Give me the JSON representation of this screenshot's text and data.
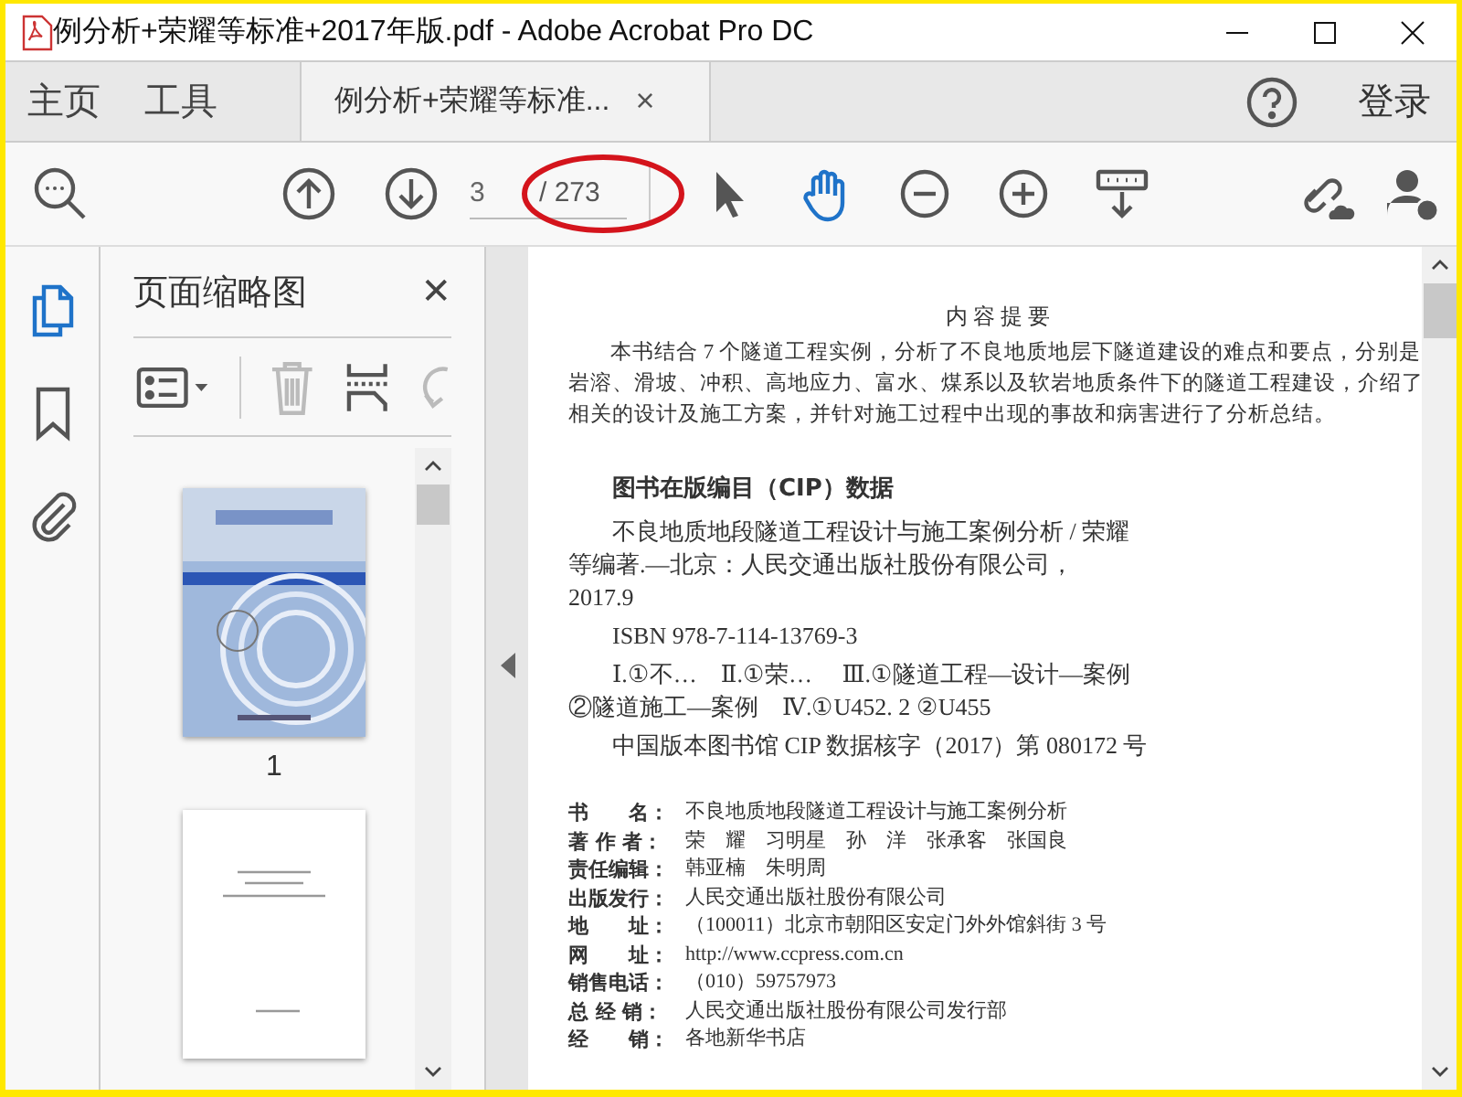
{
  "window": {
    "title": "例分析+荣耀等标准+2017年版.pdf - Adobe Acrobat Pro DC"
  },
  "nav_tabs": [
    {
      "label": "主页",
      "selected": false
    },
    {
      "label": "工具",
      "selected": false
    }
  ],
  "document_tab": {
    "label": "例分析+荣耀等标准...",
    "close": "×"
  },
  "account": {
    "login": "登录"
  },
  "toolbar": {
    "page_number": "3",
    "page_total": "/ 273",
    "tools": [
      {
        "kind": "select",
        "selected": false
      },
      {
        "kind": "hand",
        "selected": true
      }
    ]
  },
  "side_rail": [
    {
      "kind": "pages",
      "selected": true
    },
    {
      "kind": "bookmarks",
      "selected": false
    },
    {
      "kind": "attachments",
      "selected": false
    }
  ],
  "thumbnail_panel": {
    "title": "页面缩略图",
    "close": "✕",
    "thumbnails": [
      {
        "kind": "picture",
        "label": "1",
        "selected": false
      },
      {
        "kind": "page",
        "selected": false
      }
    ]
  },
  "page": {
    "heading": "内 容 提 要",
    "summary": "本书结合 7 个隧道工程实例，分析了不良地质地层下隧道建设的难点和要点，分别是岩溶、滑坡、冲积、高地应力、富水、煤系以及软岩地质条件下的隧道工程建设，介绍了相关的设计及施工方案，并针对施工过程中出现的事故和病害进行了分析总结。",
    "cip_title": "图书在版编目（CIP）数据",
    "cip_lines": [
      {
        "text": "不良地质地段隧道工程设计与施工案例分析 / 荣耀",
        "indent": true
      },
      {
        "text": "等编著.—北京：人民交通出版社股份有限公司，",
        "indent": false
      },
      {
        "text": "2017.9",
        "indent": false
      },
      {
        "text": "ISBN 978-7-114-13769-3",
        "indent": true
      },
      {
        "text": "Ⅰ.①不…　Ⅱ.①荣…　 Ⅲ.①隧道工程—设计—案例",
        "indent": true
      },
      {
        "text": "②隧道施工—案例　Ⅳ.①U452. 2 ②U455",
        "indent": false
      },
      {
        "text": "中国版本图书馆 CIP 数据核字（2017）第 080172 号",
        "indent": true
      }
    ],
    "details": [
      {
        "label": "书　　名：",
        "value": "不良地质地段隧道工程设计与施工案例分析"
      },
      {
        "label": "著 作 者：",
        "value": "荣　耀　习明星　孙　洋　张承客　张国良"
      },
      {
        "label": "责任编辑：",
        "value": "韩亚楠　朱明周"
      },
      {
        "label": "出版发行：",
        "value": "人民交通出版社股份有限公司"
      },
      {
        "label": "地　　址：",
        "value": "（100011）北京市朝阳区安定门外外馆斜街 3 号"
      },
      {
        "label": "网　　址：",
        "value": "http://www.ccpress.com.cn"
      },
      {
        "label": "销售电话：",
        "value": "（010）59757973"
      },
      {
        "label": "总 经 销：",
        "value": "人民交通出版社股份有限公司发行部"
      },
      {
        "label": "经　　销：",
        "value": "各地新华书店"
      }
    ]
  }
}
